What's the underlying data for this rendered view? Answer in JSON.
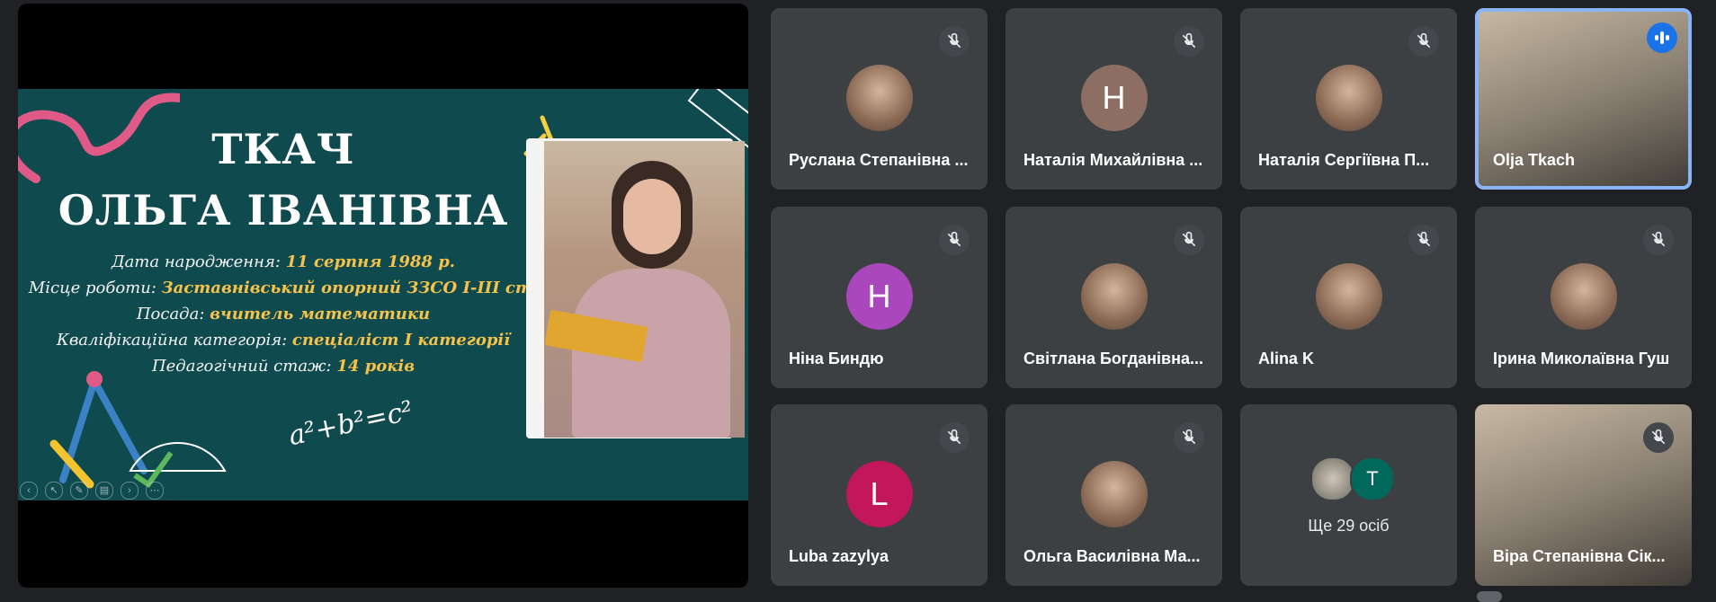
{
  "presentation": {
    "slide": {
      "surname": "ТКАЧ",
      "full_name": "ОЛЬГА ІВАНІВНА",
      "formula": "a²+b²=c²",
      "rows": [
        {
          "label": "Дата народження: ",
          "value": "11 серпня 1988 р."
        },
        {
          "label": "Місце роботи: ",
          "value": "Заставнівський опорний ЗЗСО І-ІІІ ст."
        },
        {
          "label": "Посада: ",
          "value": "вчитель математики"
        },
        {
          "label": "Кваліфікаційна категорія: ",
          "value": "спеціаліст І категорії"
        },
        {
          "label": "Педагогічний стаж: ",
          "value": "14 років"
        }
      ]
    }
  },
  "participants": [
    {
      "name": "Руслана Степанівна ...",
      "avatar_type": "photo",
      "muted": true
    },
    {
      "name": "Наталія Михайлівна ...",
      "avatar_type": "letter",
      "letter": "Н",
      "color": "#8d6e63",
      "muted": true
    },
    {
      "name": "Наталія Сергіївна П...",
      "avatar_type": "photo",
      "muted": true
    },
    {
      "name": "Olja Tkach",
      "avatar_type": "video",
      "muted": false,
      "speaking": true
    },
    {
      "name": "Ніна Биндю",
      "avatar_type": "letter",
      "letter": "Н",
      "color": "#ab47bc",
      "muted": true
    },
    {
      "name": "Світлана Богданівна...",
      "avatar_type": "photo",
      "muted": true
    },
    {
      "name": "Alina K",
      "avatar_type": "photo",
      "muted": true
    },
    {
      "name": "Ірина Миколаївна Гуш",
      "avatar_type": "photo",
      "muted": true
    },
    {
      "name": "Luba zazylya",
      "avatar_type": "letter",
      "letter": "L",
      "color": "#c2185b",
      "muted": true
    },
    {
      "name": "Ольга Василівна Ма...",
      "avatar_type": "photo",
      "muted": true
    },
    {
      "name": "",
      "avatar_type": "more",
      "more_label": "Ще 29 осіб",
      "more_letter": "T",
      "more_color": "#00695c"
    },
    {
      "name": "Віра Степанівна Сік...",
      "avatar_type": "video",
      "muted": true
    }
  ],
  "icons": {
    "mic_off": "mic-off-icon",
    "speaking": "audio-level-icon"
  }
}
